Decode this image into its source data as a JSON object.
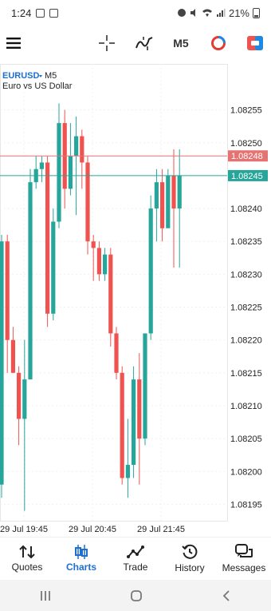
{
  "status": {
    "time": "1:24",
    "battery": "21%"
  },
  "toolbar": {
    "timeframe": "M5",
    "icons": [
      "menu-icon",
      "crosshair-icon",
      "indicator-icon",
      "timeframe-label",
      "trade-app-icon",
      "one-click-icon"
    ]
  },
  "symbol": {
    "name": "EURUSD",
    "timeframe": "M5",
    "description": "Euro vs US Dollar"
  },
  "colors": {
    "bull": "#26a69a",
    "bear": "#ef5350",
    "bid_line": "#26a69a",
    "ask_line": "#e57373",
    "active": "#1e6fd0"
  },
  "price_labels": {
    "ask": "1.08248",
    "bid": "1.08245"
  },
  "chart_data": {
    "type": "candlestick",
    "y_ticks": [
      "1.08255",
      "1.08250",
      "1.08240",
      "1.08235",
      "1.08230",
      "1.08225",
      "1.08220",
      "1.08215",
      "1.08210",
      "1.08205",
      "1.08200",
      "1.08195"
    ],
    "x_ticks": [
      "29 Jul 19:45",
      "29 Jul 20:45",
      "29 Jul 21:45"
    ],
    "ylim": [
      1.081925,
      1.08262
    ],
    "ask": 1.08248,
    "bid": 1.08245,
    "candles": [
      [
        1.08198,
        1.08236,
        1.08196,
        1.08235
      ],
      [
        1.08235,
        1.08236,
        1.08215,
        1.0822
      ],
      [
        1.0822,
        1.08222,
        1.08215,
        1.08215
      ],
      [
        1.08215,
        1.08216,
        1.08204,
        1.08208
      ],
      [
        1.08208,
        1.0822,
        1.08194,
        1.08214
      ],
      [
        1.08214,
        1.08246,
        1.08214,
        1.08244
      ],
      [
        1.08244,
        1.08248,
        1.08243,
        1.08246
      ],
      [
        1.08246,
        1.08248,
        1.08244,
        1.08247
      ],
      [
        1.08247,
        1.08248,
        1.08222,
        1.08224
      ],
      [
        1.08224,
        1.0824,
        1.08223,
        1.08238
      ],
      [
        1.08238,
        1.08256,
        1.08237,
        1.08253
      ],
      [
        1.08253,
        1.08255,
        1.0824,
        1.08243
      ],
      [
        1.08243,
        1.08253,
        1.08242,
        1.08248
      ],
      [
        1.08248,
        1.08254,
        1.08239,
        1.08251
      ],
      [
        1.08251,
        1.08252,
        1.08243,
        1.08247
      ],
      [
        1.08247,
        1.08248,
        1.08233,
        1.08235
      ],
      [
        1.08235,
        1.08236,
        1.08229,
        1.08234
      ],
      [
        1.08234,
        1.08235,
        1.08229,
        1.0823
      ],
      [
        1.0823,
        1.08234,
        1.08229,
        1.08233
      ],
      [
        1.08233,
        1.08234,
        1.08219,
        1.08221
      ],
      [
        1.08221,
        1.08222,
        1.08214,
        1.08215
      ],
      [
        1.08215,
        1.08216,
        1.08198,
        1.08199
      ],
      [
        1.08199,
        1.08208,
        1.08196,
        1.08201
      ],
      [
        1.08201,
        1.08216,
        1.08199,
        1.08214
      ],
      [
        1.08214,
        1.08218,
        1.08198,
        1.08205
      ],
      [
        1.08205,
        1.08221,
        1.08204,
        1.08221
      ],
      [
        1.08221,
        1.08242,
        1.0822,
        1.0824
      ],
      [
        1.0824,
        1.08246,
        1.08235,
        1.08244
      ],
      [
        1.08244,
        1.08246,
        1.08235,
        1.08237
      ],
      [
        1.08237,
        1.08246,
        1.08238,
        1.08245
      ],
      [
        1.08245,
        1.08249,
        1.08231,
        1.0824
      ],
      [
        1.0824,
        1.08249,
        1.08231,
        1.08245
      ]
    ]
  },
  "nav": {
    "quotes": "Quotes",
    "charts": "Charts",
    "trade": "Trade",
    "history": "History",
    "messages": "Messages"
  }
}
